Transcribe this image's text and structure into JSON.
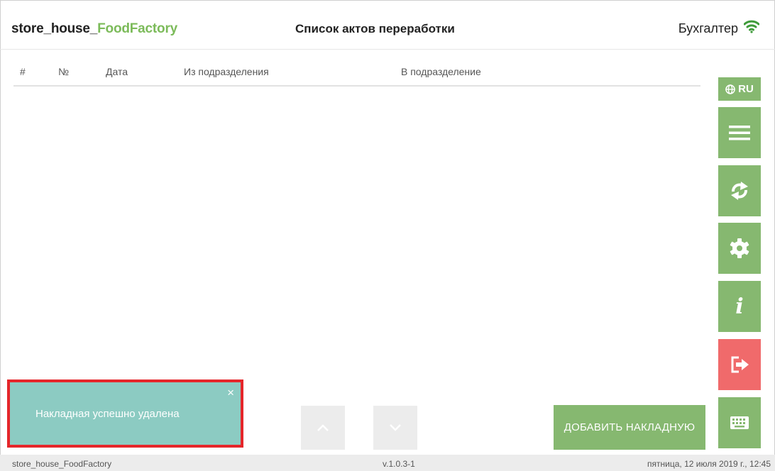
{
  "header": {
    "app_name_main": "store_house_",
    "app_name_accent": "FoodFactory",
    "page_title": "Список актов переработки",
    "user": "Бухгалтер",
    "wifi_icon": "wifi-icon",
    "accent_color": "#7cbb5a"
  },
  "table": {
    "columns": [
      "#",
      "№",
      "Дата",
      "Из подразделения",
      "В подразделение"
    ],
    "rows": []
  },
  "sidebar": {
    "lang_label": "RU",
    "lang_icon": "globe-icon",
    "buttons": [
      "menu-icon",
      "sync-icon",
      "gear-icon",
      "info-icon",
      "logout-icon",
      "keyboard-icon"
    ],
    "info_glyph": "i",
    "button_color": "#86b870",
    "logout_color": "#f06a6b"
  },
  "toast": {
    "message": "Накладная успешно удалена",
    "close": "×",
    "color": "#8ccbc2"
  },
  "actions": {
    "add_label": "ДОБАВИТЬ НАКЛАДНУЮ"
  },
  "footer": {
    "app": "store_house_FoodFactory",
    "version": "v.1.0.3-1",
    "datetime": "пятница, 12 июля 2019 г., 12:45"
  }
}
